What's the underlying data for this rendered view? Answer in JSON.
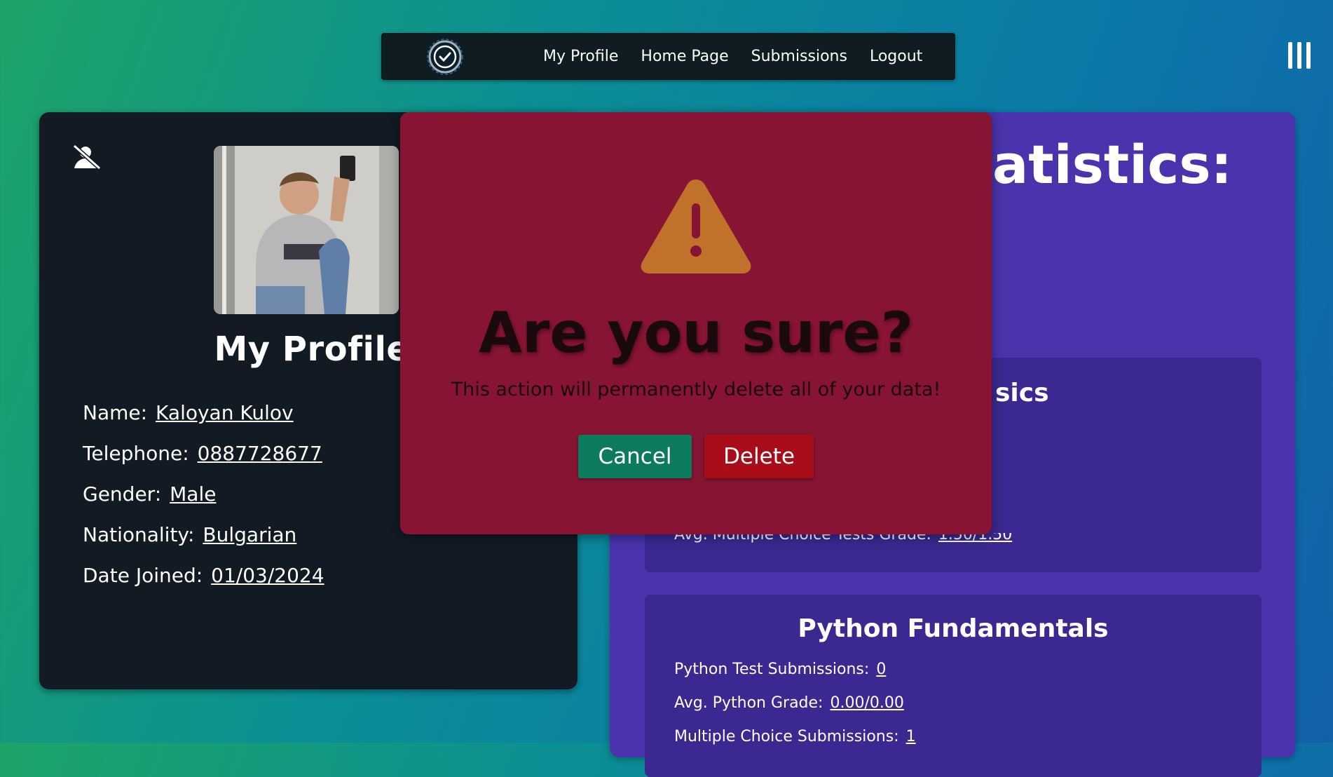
{
  "nav": {
    "links": [
      "My Profile",
      "Home Page",
      "Submissions",
      "Logout"
    ]
  },
  "profile": {
    "title": "My Profile",
    "fields": [
      {
        "label": "Name:",
        "value": "Kaloyan Kulov"
      },
      {
        "label": "Telephone:",
        "value": "0887728677"
      },
      {
        "label": "Gender:",
        "value": "Male"
      },
      {
        "label": "Nationality:",
        "value": "Bulgarian"
      },
      {
        "label": "Date Joined:",
        "value": "01/03/2024"
      }
    ]
  },
  "stats": {
    "title_visible": "atistics:",
    "section1": {
      "title_visible": "sics",
      "row_visible": {
        "label": "Avg. Multiple Choice Tests Grade:",
        "value": "1.50/1.50"
      }
    },
    "section2": {
      "title": "Python Fundamentals",
      "rows": [
        {
          "label": "Python Test Submissions:",
          "value": "0"
        },
        {
          "label": "Avg. Python Grade:",
          "value": "0.00/0.00"
        },
        {
          "label": "Multiple Choice Submissions:",
          "value": "1"
        }
      ]
    }
  },
  "modal": {
    "title": "Are you sure?",
    "message": "This action will permanently delete all of your data!",
    "cancel_label": "Cancel",
    "delete_label": "Delete"
  },
  "colors": {
    "modal_bg": "#861432",
    "cancel_bg": "#0c7a5c",
    "delete_bg": "#a90d1a",
    "warning_icon": "#c0722a",
    "stats_panel": "#4a33ac"
  }
}
